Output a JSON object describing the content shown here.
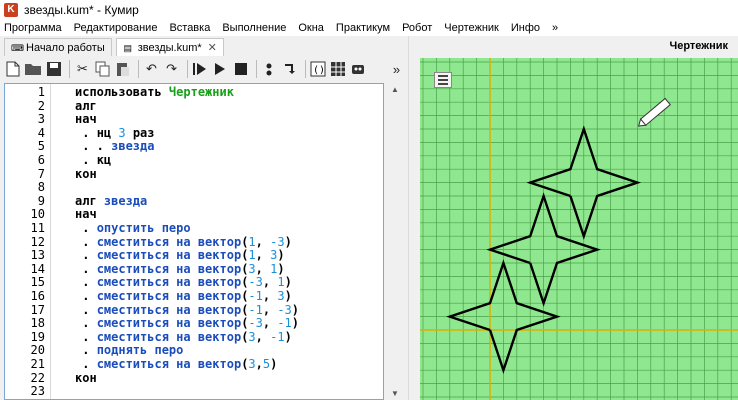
{
  "window": {
    "title": "звезды.kum* - Кумир",
    "app_icon_letter": "K"
  },
  "menu": [
    "Программа",
    "Редактирование",
    "Вставка",
    "Выполнение",
    "Окна",
    "Практикум",
    "Робот",
    "Чертежник",
    "Инфо",
    "»"
  ],
  "tabs": [
    {
      "label": "Начало работы",
      "icon": "keyboard-icon",
      "active": false
    },
    {
      "label": "звезды.kum*",
      "icon": "file-icon",
      "active": true,
      "close": "✕"
    }
  ],
  "toolbar": {
    "icons": [
      "new-file-icon",
      "open-folder-icon",
      "save-icon",
      "cut-icon",
      "copy-icon",
      "paste-icon",
      "undo-icon",
      "redo-icon",
      "run-icon",
      "step-run-icon",
      "stop-icon",
      "step-icon",
      "step-into-icon",
      "variables-icon",
      "grid-icon",
      "robot-icon"
    ],
    "overflow": "»"
  },
  "editor": {
    "lines": [
      {
        "n": "1",
        "parts": [
          {
            "t": "использовать ",
            "c": "kw"
          },
          {
            "t": "Чертежник",
            "c": "green"
          }
        ]
      },
      {
        "n": "2",
        "parts": [
          {
            "t": "алг",
            "c": "kw"
          }
        ]
      },
      {
        "n": "3",
        "parts": [
          {
            "t": "нач",
            "c": "kw"
          }
        ]
      },
      {
        "n": "4",
        "parts": [
          {
            "t": " . ",
            "c": "dot"
          },
          {
            "t": "нц ",
            "c": "kw"
          },
          {
            "t": "3",
            "c": "num"
          },
          {
            "t": " раз",
            "c": "kw"
          }
        ]
      },
      {
        "n": "5",
        "parts": [
          {
            "t": " . . ",
            "c": "dot"
          },
          {
            "t": "звезда",
            "c": "blue"
          }
        ]
      },
      {
        "n": "6",
        "parts": [
          {
            "t": " . ",
            "c": "dot"
          },
          {
            "t": "кц",
            "c": "kw"
          }
        ]
      },
      {
        "n": "7",
        "parts": [
          {
            "t": "кон",
            "c": "kw"
          }
        ]
      },
      {
        "n": "8",
        "parts": []
      },
      {
        "n": "9",
        "parts": [
          {
            "t": "алг ",
            "c": "kw"
          },
          {
            "t": "звезда",
            "c": "blue"
          }
        ]
      },
      {
        "n": "10",
        "parts": [
          {
            "t": "нач",
            "c": "kw"
          }
        ]
      },
      {
        "n": "11",
        "parts": [
          {
            "t": " . ",
            "c": "dot"
          },
          {
            "t": "опустить перо",
            "c": "blue"
          }
        ]
      },
      {
        "n": "12",
        "parts": [
          {
            "t": " . ",
            "c": "dot"
          },
          {
            "t": "сместиться на вектор",
            "c": "blue"
          },
          {
            "t": "(",
            "c": "kw"
          },
          {
            "t": "1",
            "c": "num"
          },
          {
            "t": ", ",
            "c": "kw"
          },
          {
            "t": "-3",
            "c": "num"
          },
          {
            "t": ")",
            "c": "kw"
          }
        ]
      },
      {
        "n": "13",
        "parts": [
          {
            "t": " . ",
            "c": "dot"
          },
          {
            "t": "сместиться на вектор",
            "c": "blue"
          },
          {
            "t": "(",
            "c": "kw"
          },
          {
            "t": "1",
            "c": "num"
          },
          {
            "t": ", ",
            "c": "kw"
          },
          {
            "t": "3",
            "c": "num"
          },
          {
            "t": ")",
            "c": "kw"
          }
        ]
      },
      {
        "n": "14",
        "parts": [
          {
            "t": " . ",
            "c": "dot"
          },
          {
            "t": "сместиться на вектор",
            "c": "blue"
          },
          {
            "t": "(",
            "c": "kw"
          },
          {
            "t": "3",
            "c": "num"
          },
          {
            "t": ", ",
            "c": "kw"
          },
          {
            "t": "1",
            "c": "num"
          },
          {
            "t": ")",
            "c": "kw"
          }
        ]
      },
      {
        "n": "15",
        "parts": [
          {
            "t": " . ",
            "c": "dot"
          },
          {
            "t": "сместиться на вектор",
            "c": "blue"
          },
          {
            "t": "(",
            "c": "kw"
          },
          {
            "t": "-3",
            "c": "num"
          },
          {
            "t": ", ",
            "c": "kw"
          },
          {
            "t": "1",
            "c": "num"
          },
          {
            "t": ")",
            "c": "kw"
          }
        ]
      },
      {
        "n": "16",
        "parts": [
          {
            "t": " . ",
            "c": "dot"
          },
          {
            "t": "сместиться на вектор",
            "c": "blue"
          },
          {
            "t": "(",
            "c": "kw"
          },
          {
            "t": "-1",
            "c": "num"
          },
          {
            "t": ", ",
            "c": "kw"
          },
          {
            "t": "3",
            "c": "num"
          },
          {
            "t": ")",
            "c": "kw"
          }
        ]
      },
      {
        "n": "17",
        "parts": [
          {
            "t": " . ",
            "c": "dot"
          },
          {
            "t": "сместиться на вектор",
            "c": "blue"
          },
          {
            "t": "(",
            "c": "kw"
          },
          {
            "t": "-1",
            "c": "num"
          },
          {
            "t": ", ",
            "c": "kw"
          },
          {
            "t": "-3",
            "c": "num"
          },
          {
            "t": ")",
            "c": "kw"
          }
        ]
      },
      {
        "n": "18",
        "parts": [
          {
            "t": " . ",
            "c": "dot"
          },
          {
            "t": "сместиться на вектор",
            "c": "blue"
          },
          {
            "t": "(",
            "c": "kw"
          },
          {
            "t": "-3",
            "c": "num"
          },
          {
            "t": ", ",
            "c": "kw"
          },
          {
            "t": "-1",
            "c": "num"
          },
          {
            "t": ")",
            "c": "kw"
          }
        ]
      },
      {
        "n": "19",
        "parts": [
          {
            "t": " . ",
            "c": "dot"
          },
          {
            "t": "сместиться на вектор",
            "c": "blue"
          },
          {
            "t": "(",
            "c": "kw"
          },
          {
            "t": "3",
            "c": "num"
          },
          {
            "t": ", ",
            "c": "kw"
          },
          {
            "t": "-1",
            "c": "num"
          },
          {
            "t": ")",
            "c": "kw"
          }
        ]
      },
      {
        "n": "20",
        "parts": [
          {
            "t": " . ",
            "c": "dot"
          },
          {
            "t": "поднять перо",
            "c": "blue"
          }
        ]
      },
      {
        "n": "21",
        "parts": [
          {
            "t": " . ",
            "c": "dot"
          },
          {
            "t": "сместиться на вектор",
            "c": "blue"
          },
          {
            "t": "(",
            "c": "kw"
          },
          {
            "t": "3",
            "c": "num"
          },
          {
            "t": ",",
            "c": "kw"
          },
          {
            "t": "5",
            "c": "num"
          },
          {
            "t": ")",
            "c": "kw"
          }
        ]
      },
      {
        "n": "22",
        "parts": [
          {
            "t": "кон",
            "c": "kw"
          }
        ]
      },
      {
        "n": "23",
        "parts": []
      }
    ]
  },
  "drawer": {
    "title": "Чертежник",
    "menu_icon": "hamburger-menu-icon",
    "pen_icon": "pencil-icon",
    "colors": {
      "background": "#8fe88f",
      "grid": "#4aa04a",
      "axis": "#d8b000",
      "stroke": "#000000"
    },
    "figures": [
      {
        "name": "star-1",
        "start": [
          0,
          0
        ]
      },
      {
        "name": "star-2",
        "start": [
          3,
          5
        ]
      },
      {
        "name": "star-3",
        "start": [
          6,
          10
        ]
      }
    ],
    "star_moves": [
      [
        1,
        -3
      ],
      [
        1,
        3
      ],
      [
        3,
        1
      ],
      [
        -3,
        1
      ],
      [
        -1,
        3
      ],
      [
        -1,
        -3
      ],
      [
        -3,
        -1
      ],
      [
        3,
        -1
      ]
    ],
    "pen_end": [
      9,
      15
    ]
  }
}
